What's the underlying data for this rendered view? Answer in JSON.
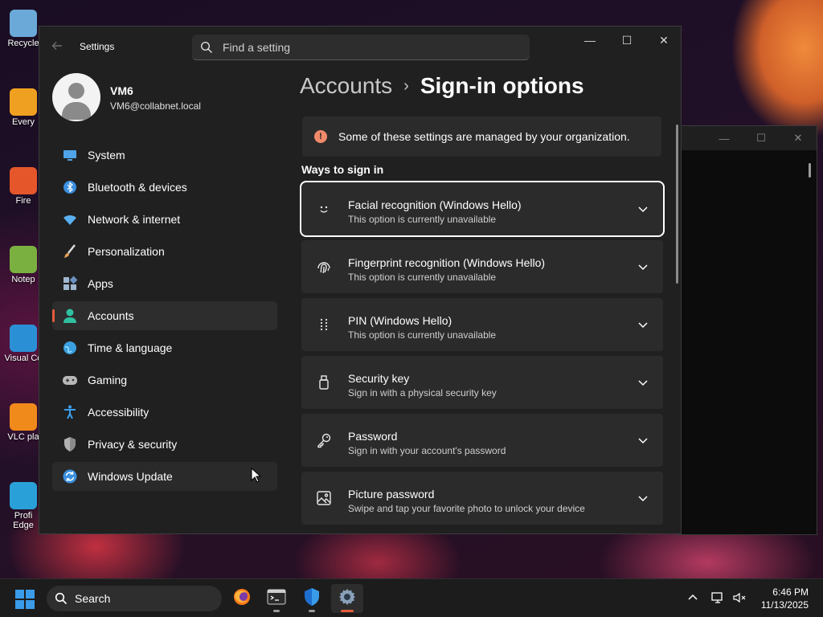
{
  "desktop": {
    "icons": [
      {
        "label": "Recycle",
        "color": "#6aa9d8"
      },
      {
        "label": "Every",
        "color": "#f0a020"
      },
      {
        "label": "Fire",
        "color": "#e5562a"
      },
      {
        "label": "Notep",
        "color": "#7ab040"
      },
      {
        "label": "Visual Co",
        "color": "#2b8fd6"
      },
      {
        "label": "VLC pla",
        "color": "#f08a1a"
      },
      {
        "label": "Profi Edge",
        "color": "#2aa0d8"
      }
    ]
  },
  "window": {
    "app_title": "Settings",
    "search_placeholder": "Find a setting",
    "controls": {
      "minimize": "—",
      "maximize": "☐",
      "close": "✕"
    }
  },
  "profile": {
    "name": "VM6",
    "email": "VM6@collabnet.local"
  },
  "sidebar": {
    "items": [
      {
        "label": "System",
        "icon": "monitor-icon",
        "color": "#4fa3e8"
      },
      {
        "label": "Bluetooth & devices",
        "icon": "bluetooth-icon",
        "color": "#3a8fe0"
      },
      {
        "label": "Network & internet",
        "icon": "wifi-icon",
        "color": "#5ab0f0"
      },
      {
        "label": "Personalization",
        "icon": "brush-icon",
        "color": "#e8a35a"
      },
      {
        "label": "Apps",
        "icon": "apps-icon",
        "color": "#9fb7d0"
      },
      {
        "label": "Accounts",
        "icon": "person-icon",
        "color": "#2fc0a0",
        "active": true
      },
      {
        "label": "Time & language",
        "icon": "globe-icon",
        "color": "#3aa0e0"
      },
      {
        "label": "Gaming",
        "icon": "gamepad-icon",
        "color": "#b8b8b8"
      },
      {
        "label": "Accessibility",
        "icon": "accessibility-icon",
        "color": "#3aa0f0"
      },
      {
        "label": "Privacy & security",
        "icon": "shield-icon",
        "color": "#b0b0b0"
      },
      {
        "label": "Windows Update",
        "icon": "update-icon",
        "color": "#3a90e0",
        "hover": true
      }
    ]
  },
  "breadcrumb": {
    "parent": "Accounts",
    "separator": "›",
    "current": "Sign-in options"
  },
  "notice": {
    "icon": "!",
    "text": "Some of these settings are managed by your organization."
  },
  "ways": {
    "title": "Ways to sign in",
    "options": [
      {
        "title": "Facial recognition (Windows Hello)",
        "subtitle": "This option is currently unavailable",
        "icon": "face-icon",
        "focused": true
      },
      {
        "title": "Fingerprint recognition (Windows Hello)",
        "subtitle": "This option is currently unavailable",
        "icon": "fingerprint-icon"
      },
      {
        "title": "PIN (Windows Hello)",
        "subtitle": "This option is currently unavailable",
        "icon": "pin-keypad-icon"
      },
      {
        "title": "Security key",
        "subtitle": "Sign in with a physical security key",
        "icon": "usb-key-icon"
      },
      {
        "title": "Password",
        "subtitle": "Sign in with your account's password",
        "icon": "key-icon"
      },
      {
        "title": "Picture password",
        "subtitle": "Swipe and tap your favorite photo to unlock your device",
        "icon": "picture-icon"
      }
    ]
  },
  "taskbar": {
    "search_placeholder": "Search",
    "apps": [
      {
        "name": "firefox-icon"
      },
      {
        "name": "terminal-icon"
      },
      {
        "name": "defender-shield-icon"
      },
      {
        "name": "settings-gear-icon",
        "active": true
      }
    ],
    "clock": {
      "time": "6:46 PM",
      "date": "11/13/2025"
    }
  }
}
